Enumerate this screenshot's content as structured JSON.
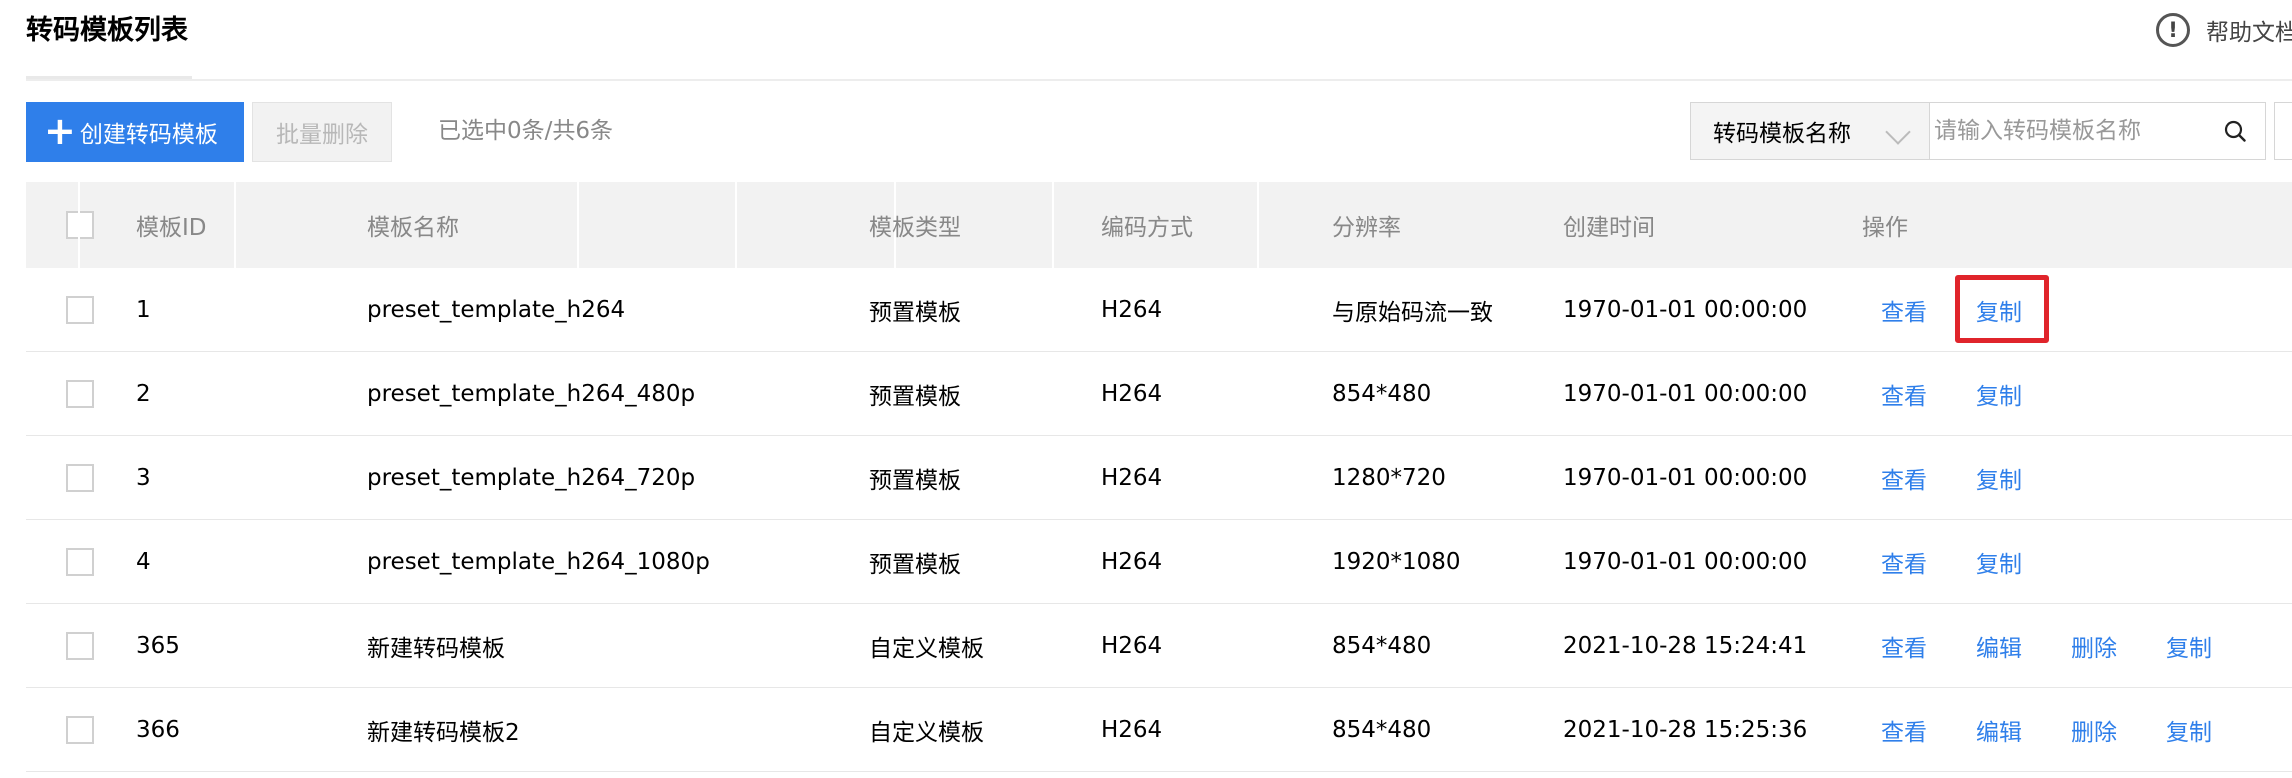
{
  "header": {
    "title": "转码模板列表",
    "help_label": "帮助文档"
  },
  "toolbar": {
    "create_label": "创建转码模板",
    "batch_delete_label": "批量删除",
    "selection_status": "已选中0条/共6条",
    "search_field_label": "转码模板名称",
    "search_placeholder": "请输入转码模板名称"
  },
  "table": {
    "columns": [
      "模板ID",
      "模板名称",
      "模板类型",
      "编码方式",
      "分辨率",
      "创建时间",
      "操作"
    ],
    "rows": [
      {
        "id": "1",
        "name": "preset_template_h264",
        "type": "预置模板",
        "codec": "H264",
        "resolution": "与原始码流一致",
        "created": "1970-01-01 00:00:00",
        "actions": [
          "查看",
          "复制"
        ]
      },
      {
        "id": "2",
        "name": "preset_template_h264_480p",
        "type": "预置模板",
        "codec": "H264",
        "resolution": "854*480",
        "created": "1970-01-01 00:00:00",
        "actions": [
          "查看",
          "复制"
        ]
      },
      {
        "id": "3",
        "name": "preset_template_h264_720p",
        "type": "预置模板",
        "codec": "H264",
        "resolution": "1280*720",
        "created": "1970-01-01 00:00:00",
        "actions": [
          "查看",
          "复制"
        ]
      },
      {
        "id": "4",
        "name": "preset_template_h264_1080p",
        "type": "预置模板",
        "codec": "H264",
        "resolution": "1920*1080",
        "created": "1970-01-01 00:00:00",
        "actions": [
          "查看",
          "复制"
        ]
      },
      {
        "id": "365",
        "name": "新建转码模板",
        "type": "自定义模板",
        "codec": "H264",
        "resolution": "854*480",
        "created": "2021-10-28 15:24:41",
        "actions": [
          "查看",
          "编辑",
          "删除",
          "复制"
        ]
      },
      {
        "id": "366",
        "name": "新建转码模板2",
        "type": "自定义模板",
        "codec": "H264",
        "resolution": "854*480",
        "created": "2021-10-28 15:25:36",
        "actions": [
          "查看",
          "编辑",
          "删除",
          "复制"
        ]
      }
    ]
  },
  "colors": {
    "primary": "#2f7fea",
    "highlight": "#e0242b",
    "header_bg": "#f2f2f2",
    "muted_text": "#888888"
  },
  "icons": [
    "help-circle-icon",
    "plus-icon",
    "chevron-down-icon",
    "search-icon"
  ]
}
